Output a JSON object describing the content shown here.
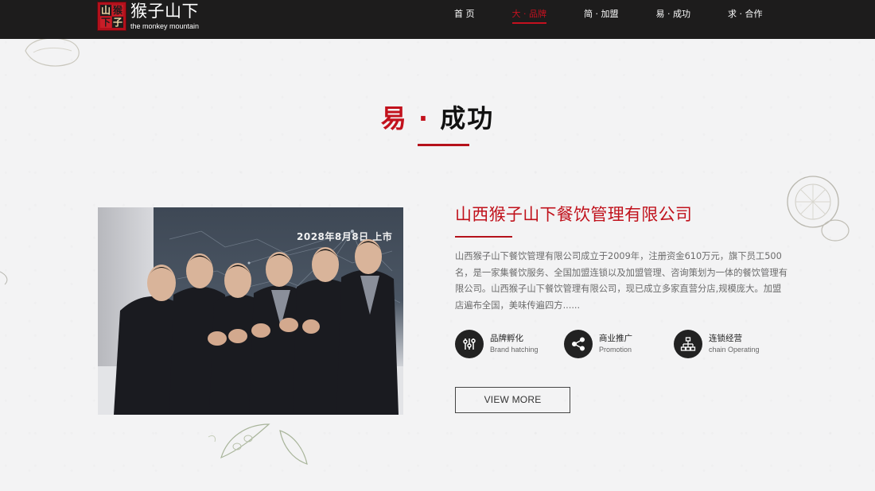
{
  "header": {
    "logo_seal_chars": [
      "山",
      "猴",
      "下",
      "子"
    ],
    "logo_cn": "猴子山下",
    "logo_en": "the monkey mountain",
    "nav": [
      {
        "label": "首 页",
        "active": false
      },
      {
        "label": "大 · 品牌",
        "active": true
      },
      {
        "label": "简 · 加盟",
        "active": false
      },
      {
        "label": "易 · 成功",
        "active": false
      },
      {
        "label": "求 · 合作",
        "active": false
      }
    ]
  },
  "section": {
    "title_red": "易 ·",
    "title_black": " 成功"
  },
  "photo": {
    "banner_text": "2028年8月8日 上市"
  },
  "content": {
    "company_name": "山西猴子山下餐饮管理有限公司",
    "description": "山西猴子山下餐饮管理有限公司成立于2009年，注册资金610万元，旗下员工500名，是一家集餐饮服务、全国加盟连锁以及加盟管理、咨询策划为一体的餐饮管理有限公司。山西猴子山下餐饮管理有限公司，现已成立多家直营分店,规模庞大。加盟店遍布全国，美味传遍四方......",
    "features": [
      {
        "cn": "品牌孵化",
        "en": "Brand hatching",
        "icon": "brand-icon"
      },
      {
        "cn": "商业推广",
        "en": "Promotion",
        "icon": "share-icon"
      },
      {
        "cn": "连锁经营",
        "en": "chain Operating",
        "icon": "org-chart-icon"
      }
    ],
    "more_label": "VIEW MORE"
  },
  "colors": {
    "accent": "#c2111c",
    "header_bg": "#1d1c1c",
    "page_bg": "#f3f3f4"
  }
}
